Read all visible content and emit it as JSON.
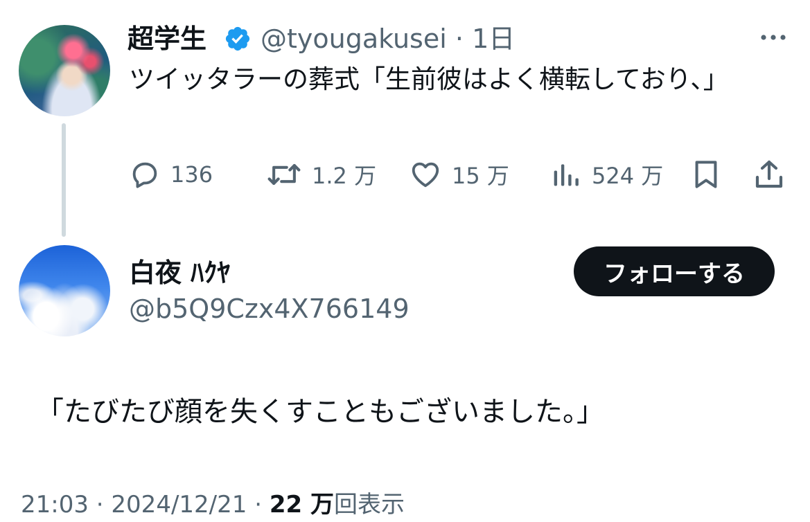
{
  "main_tweet": {
    "author_name": "超学生",
    "verified": true,
    "handle": "@tyougakusei",
    "separator": "·",
    "time_ago": "1日",
    "text": "ツイッタラーの葬式「生前彼はよく横転しており、」",
    "actions": {
      "replies": "136",
      "retweets": "1.2 万",
      "likes": "15 万",
      "views": "524 万"
    }
  },
  "reply_tweet": {
    "author_name": "白夜 ﾊｸﾔ",
    "handle": "@b5Q9Czx4X766149",
    "follow_label": "フォローする",
    "text": "「たびたび顔を失くすこともございました。」",
    "time": "21:03",
    "date": "2024/12/21",
    "separator": "·",
    "views_count": "22 万",
    "views_label": "回表示"
  },
  "colors": {
    "verified": "#1d9bf0",
    "secondary_text": "#536471",
    "primary_text": "#0f1419",
    "thread_line": "#cfd9de"
  },
  "icons": [
    "verified-icon",
    "more-icon",
    "reply-icon",
    "retweet-icon",
    "like-icon",
    "views-icon",
    "bookmark-icon",
    "share-icon"
  ]
}
